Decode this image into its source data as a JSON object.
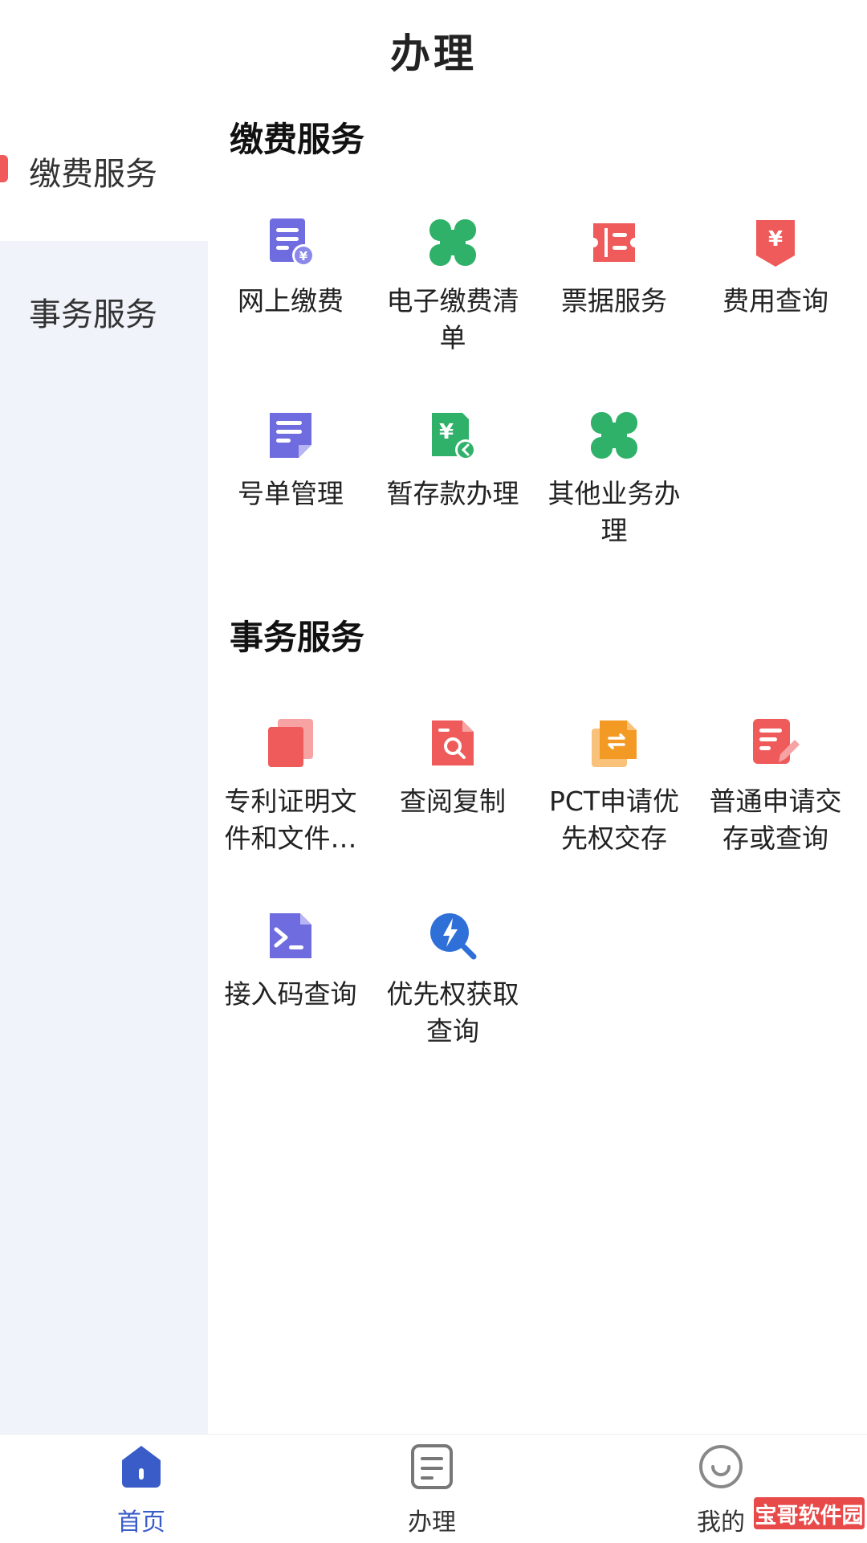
{
  "header": {
    "title": "办理"
  },
  "sidebar": {
    "items": [
      {
        "label": "缴费服务",
        "active": true
      },
      {
        "label": "事务服务",
        "active": false
      }
    ]
  },
  "sections": [
    {
      "title": "缴费服务",
      "items": [
        {
          "label": "网上缴费",
          "icon": "online-payment-icon"
        },
        {
          "label": "电子缴费清单",
          "icon": "e-payment-list-icon"
        },
        {
          "label": "票据服务",
          "icon": "ticket-icon"
        },
        {
          "label": "费用查询",
          "icon": "fee-query-icon"
        },
        {
          "label": "号单管理",
          "icon": "number-list-icon"
        },
        {
          "label": "暂存款办理",
          "icon": "deposit-icon"
        },
        {
          "label": "其他业务办理",
          "icon": "other-business-icon"
        }
      ]
    },
    {
      "title": "事务服务",
      "items": [
        {
          "label": "专利证明文件和文件…",
          "icon": "patent-certificate-icon"
        },
        {
          "label": "查阅复制",
          "icon": "document-search-icon"
        },
        {
          "label": "PCT申请优先权交存",
          "icon": "pct-priority-icon"
        },
        {
          "label": "普通申请交存或查询",
          "icon": "edit-document-icon"
        },
        {
          "label": "接入码查询",
          "icon": "access-code-icon"
        },
        {
          "label": "优先权获取查询",
          "icon": "priority-search-icon"
        }
      ]
    }
  ],
  "bottom_nav": {
    "items": [
      {
        "label": "首页",
        "icon": "home-icon",
        "active": true
      },
      {
        "label": "办理",
        "icon": "handle-icon",
        "active": false
      },
      {
        "label": "我的",
        "icon": "smile-icon",
        "active": false
      }
    ]
  },
  "watermark": {
    "text": "宝哥软件园"
  },
  "colors": {
    "accent": "#3a5cc9",
    "purple": "#6f6ce0",
    "green": "#2fb169",
    "red": "#ef5a5a",
    "orange": "#f39a25",
    "blue": "#2f6fd8",
    "sidebar_bg": "#f1f3fb"
  }
}
